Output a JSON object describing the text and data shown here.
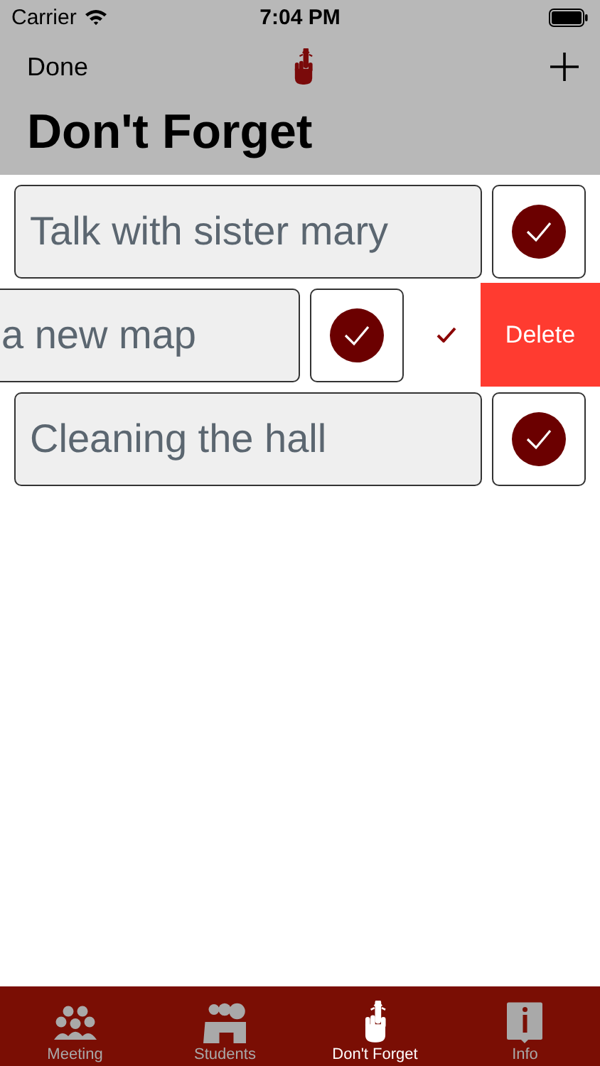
{
  "status_bar": {
    "carrier": "Carrier",
    "time": "7:04 PM"
  },
  "nav": {
    "left_button": "Done",
    "title": "Don't Forget"
  },
  "rows": [
    {
      "text": "Talk with sister mary",
      "checked": true,
      "swiped": false
    },
    {
      "text": "a new map",
      "checked": true,
      "swiped": true,
      "action": "Delete"
    },
    {
      "text": "Cleaning the hall",
      "checked": true,
      "swiped": false
    }
  ],
  "tabs": [
    {
      "label": "Meeting",
      "kind": "meeting",
      "selected": false
    },
    {
      "label": "Students",
      "kind": "students",
      "selected": false
    },
    {
      "label": "Don't Forget",
      "kind": "finger",
      "selected": true
    },
    {
      "label": "Info",
      "kind": "info",
      "selected": false
    }
  ]
}
